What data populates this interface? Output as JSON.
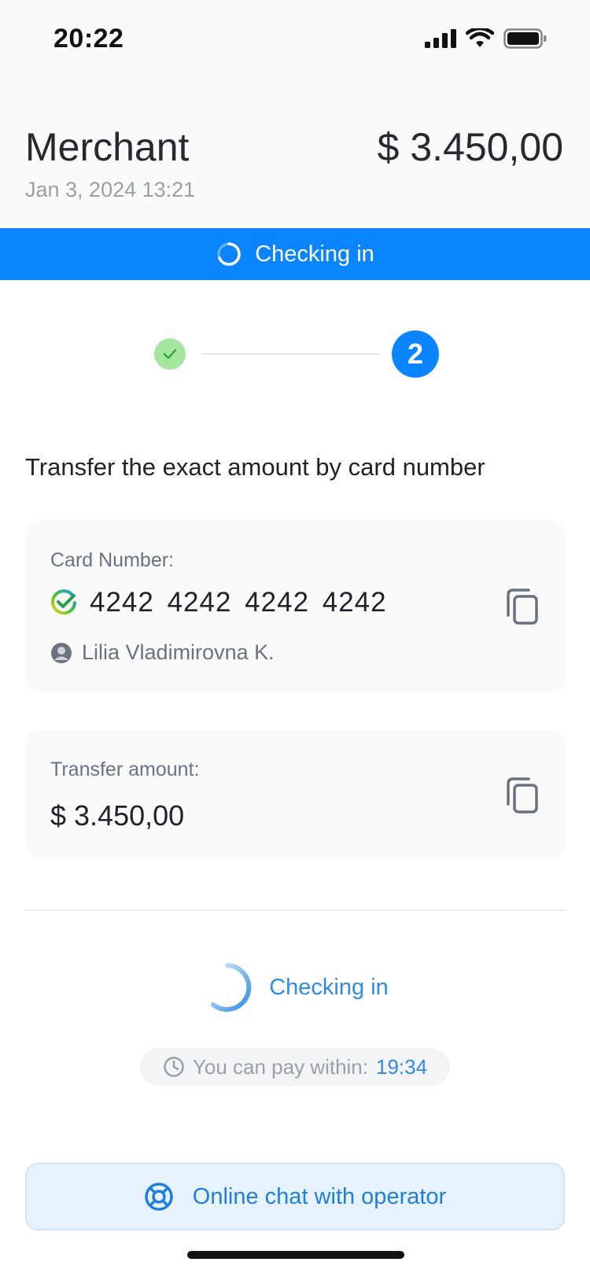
{
  "status_bar": {
    "time": "20:22"
  },
  "header": {
    "merchant": "Merchant",
    "date": "Jan 3, 2024 13:21",
    "amount": "$ 3.450,00"
  },
  "banner": {
    "text": "Checking in",
    "color": "#0a84ff"
  },
  "stepper": {
    "active_step": "2"
  },
  "instruction": "Transfer the exact amount by card number",
  "card_number_card": {
    "label": "Card Number:",
    "number": "4242 4242 4242 4242",
    "holder": "Lilia Vladimirovna K."
  },
  "amount_card": {
    "label": "Transfer amount:",
    "value": "$ 3.450,00"
  },
  "status": {
    "text": "Checking in"
  },
  "timer": {
    "label": "You can pay within:",
    "value": "19:34"
  },
  "chat_button": {
    "label": "Online chat with operator"
  },
  "colors": {
    "accent": "#0a84ff",
    "success": "#a5e6a0",
    "link": "#2f8be6"
  }
}
